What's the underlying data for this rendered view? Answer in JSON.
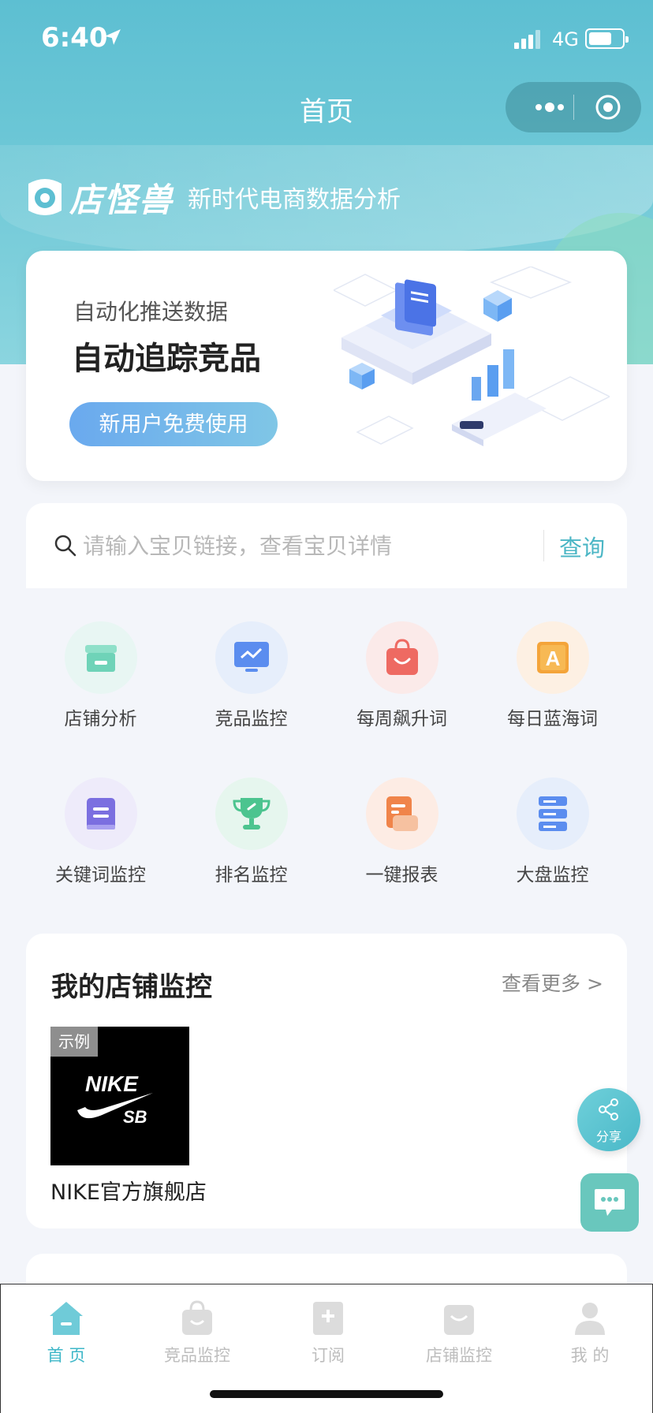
{
  "status": {
    "time": "6:40",
    "network": "4G"
  },
  "nav": {
    "title": "首页"
  },
  "brand": {
    "name": "店怪兽",
    "slogan": "新时代电商数据分析"
  },
  "banner": {
    "subtitle": "自动化推送数据",
    "title": "自动追踪竞品",
    "cta": "新用户免费使用"
  },
  "search": {
    "placeholder": "请输入宝贝链接，查看宝贝详情",
    "button": "查询"
  },
  "features": [
    {
      "label": "店铺分析",
      "icon": "store-icon",
      "color": "#6fd3b8"
    },
    {
      "label": "竞品监控",
      "icon": "monitor-chart-icon",
      "color": "#5b8def"
    },
    {
      "label": "每周飙升词",
      "icon": "shopping-bag-icon",
      "color": "#ee6a62"
    },
    {
      "label": "每日蓝海词",
      "icon": "letter-a-icon",
      "color": "#f4a43a"
    },
    {
      "label": "关键词监控",
      "icon": "book-icon",
      "color": "#7b6fe0"
    },
    {
      "label": "排名监控",
      "icon": "trophy-icon",
      "color": "#4cc48f"
    },
    {
      "label": "一键报表",
      "icon": "report-icon",
      "color": "#f0844a"
    },
    {
      "label": "大盘监控",
      "icon": "server-icon",
      "color": "#5b8def"
    }
  ],
  "store_monitor": {
    "title": "我的店铺监控",
    "more": "查看更多 >",
    "example_tag": "示例",
    "logo_text": [
      "NIKE",
      "SB"
    ],
    "store_name": "NIKE官方旗舰店"
  },
  "share": {
    "label": "分享"
  },
  "tabbar": [
    {
      "label": "首 页",
      "icon": "home-icon",
      "active": true
    },
    {
      "label": "竞品监控",
      "icon": "bag-icon",
      "active": false
    },
    {
      "label": "订阅",
      "icon": "subscribe-icon",
      "active": false
    },
    {
      "label": "店铺监控",
      "icon": "shop-icon",
      "active": false
    },
    {
      "label": "我 的",
      "icon": "user-icon",
      "active": false
    }
  ],
  "colors": {
    "primary": "#5dbfd2",
    "accent": "#3eb7c8"
  }
}
